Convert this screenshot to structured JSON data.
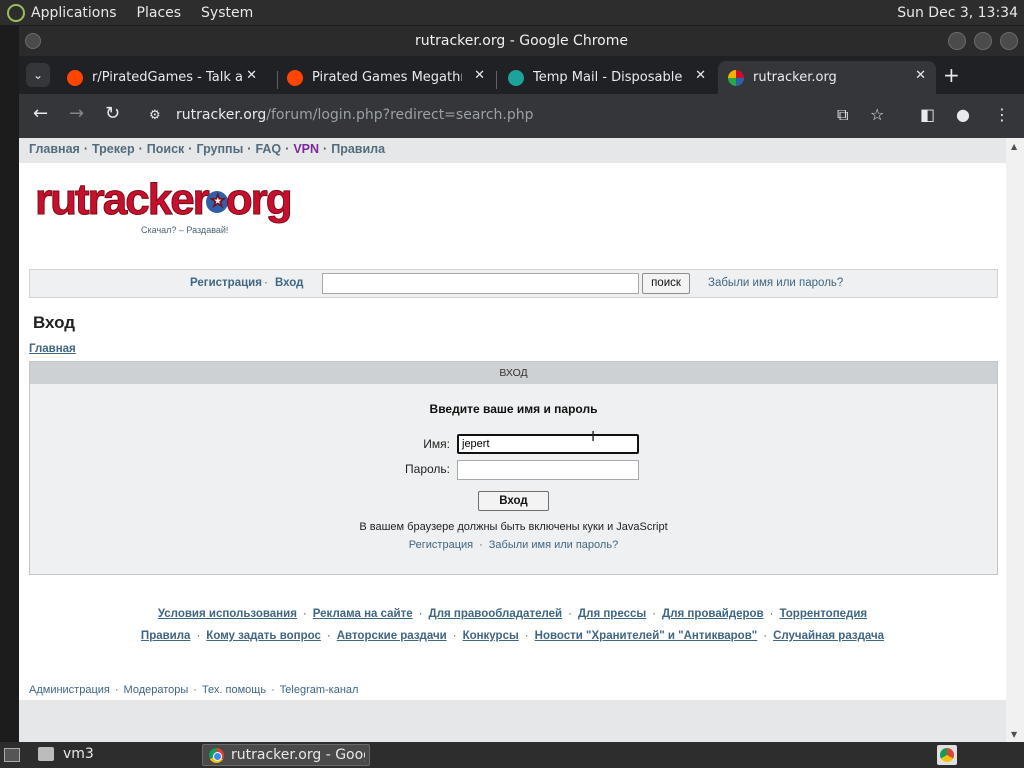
{
  "topbar": {
    "menu": [
      "Applications",
      "Places",
      "System"
    ],
    "clock": "Sun Dec  3, 13:34"
  },
  "window": {
    "title": "rutracker.org - Google Chrome"
  },
  "tabs": [
    {
      "title": "r/PiratedGames - Talk about",
      "favicon": "reddit-icon",
      "color": "#ff4500"
    },
    {
      "title": "Pirated Games Megathread",
      "favicon": "reddit-icon",
      "color": "#ff4500"
    },
    {
      "title": "Temp Mail - Disposable Temporary",
      "favicon": "tempmail-icon",
      "color": "#1ba39c"
    },
    {
      "title": "rutracker.org",
      "favicon": "rutracker-icon",
      "color": "#c8102e",
      "active": true
    }
  ],
  "address_bar": {
    "host": "rutracker.org",
    "path": "/forum/login.php?redirect=search.php"
  },
  "site_nav": {
    "items": [
      "Главная",
      "Трекер",
      "Поиск",
      "Группы",
      "FAQ",
      "VPN",
      "Правила"
    ]
  },
  "logo": {
    "text": "rutracker.org",
    "slogan": "Скачал? – Раздавай!"
  },
  "search_row": {
    "register": "Регистрация",
    "login": "Вход",
    "button": "поиск",
    "forgot": "Забыли имя или пароль?"
  },
  "page": {
    "title": "Вход",
    "breadcrumb": "Главная"
  },
  "login_box": {
    "header": "ВХОД",
    "prompt": "Введите ваше имя и пароль",
    "username_label": "Имя:",
    "username_value": "jepert",
    "password_label": "Пароль:",
    "password_value": "",
    "submit": "Вход",
    "note": "В вашем браузере должны быть включены куки и JavaScript",
    "register": "Регистрация",
    "forgot": "Забыли имя или пароль?"
  },
  "footer": {
    "row1": [
      "Условия использования",
      "Реклама на сайте",
      "Для правообладателей",
      "Для прессы",
      "Для провайдеров",
      "Торрентопедия"
    ],
    "row2": [
      "Правила",
      "Кому задать вопрос",
      "Авторские раздачи",
      "Конкурсы",
      "Новости \"Хранителей\" и \"Антикваров\"",
      "Случайная раздача"
    ],
    "admin": [
      "Администрация",
      "Модераторы",
      "Тех. помощь",
      "Telegram-канал"
    ]
  },
  "bottombar": {
    "workspace": "vm3",
    "task": "rutracker.org - Google Chrome"
  }
}
